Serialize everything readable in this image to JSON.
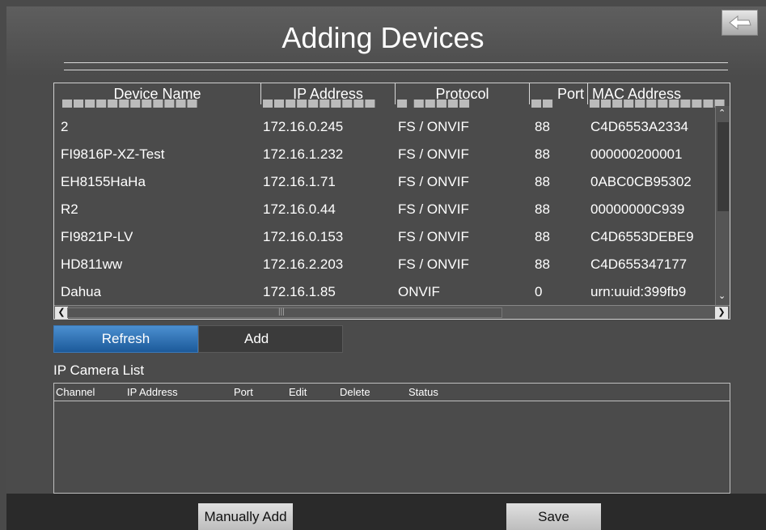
{
  "window": {
    "title": "Adding Devices"
  },
  "device_table": {
    "headers": [
      "Device Name",
      "IP Address",
      "Protocol",
      "Port",
      "MAC Address"
    ],
    "rows": [
      [
        "2",
        "172.16.0.245",
        "FS / ONVIF",
        "88",
        "C4D6553A2334"
      ],
      [
        "FI9816P-XZ-Test",
        "172.16.1.232",
        "FS / ONVIF",
        "88",
        "000000200001"
      ],
      [
        "EH8155HaHa",
        "172.16.1.71",
        "FS / ONVIF",
        "88",
        "0ABC0CB95302"
      ],
      [
        "R2",
        "172.16.0.44",
        "FS / ONVIF",
        "88",
        "00000000C939"
      ],
      [
        "FI9821P-LV",
        "172.16.0.153",
        "FS / ONVIF",
        "88",
        "C4D6553DEBE9"
      ],
      [
        "HD811ww",
        "172.16.2.203",
        "FS / ONVIF",
        "88",
        "C4D655347177"
      ],
      [
        "Dahua",
        "172.16.1.85",
        "ONVIF",
        "0",
        "urn:uuid:399fb9"
      ]
    ]
  },
  "actions": {
    "refresh": "Refresh",
    "add": "Add"
  },
  "camera_list": {
    "label": "IP Camera List",
    "headers": [
      "Channel",
      "IP Address",
      "Port",
      "Edit",
      "Delete",
      "Status"
    ]
  },
  "footer": {
    "manual_add": "Manually Add",
    "save": "Save"
  },
  "icons": {
    "back": "back-arrow-icon"
  },
  "colors": {
    "accent": "#2a6db0",
    "background": "#4b4b4b"
  }
}
